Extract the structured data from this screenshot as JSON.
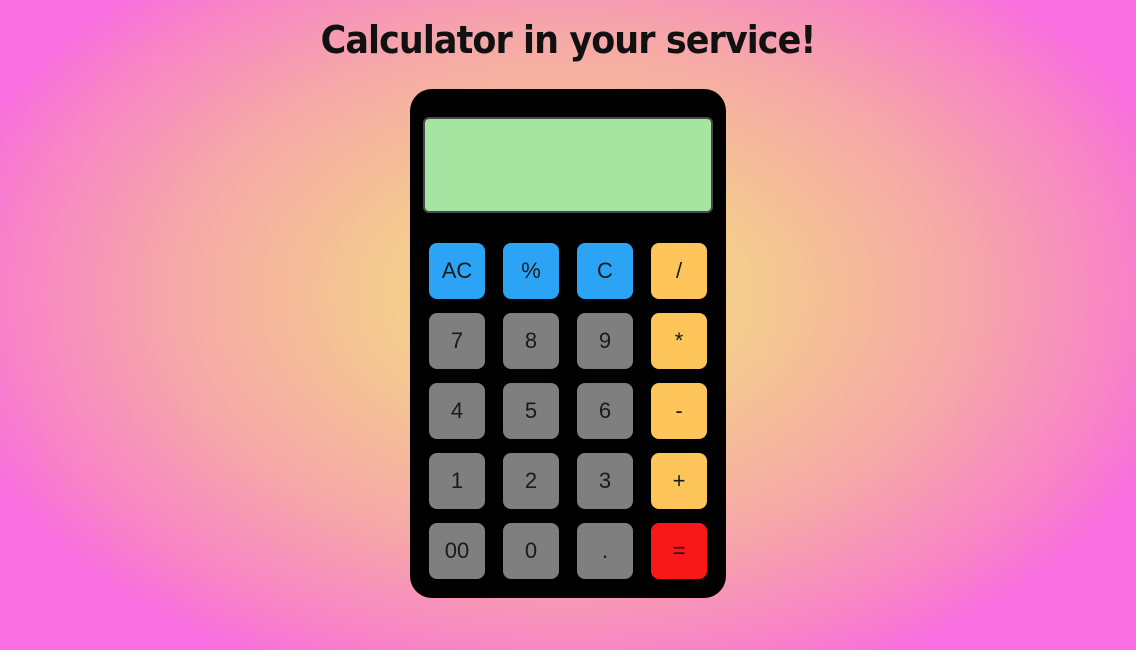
{
  "header": {
    "title": "Calculator in your service!"
  },
  "display": {
    "value": ""
  },
  "colors": {
    "function_keys": "#2ba4f6",
    "number_keys": "#7f7f7f",
    "operator_keys": "#fdc55a",
    "equals_key": "#f91818",
    "display_bg": "#a6e5a1",
    "body": "#000000"
  },
  "keys": {
    "ac": "AC",
    "percent": "%",
    "clear": "C",
    "divide": "/",
    "seven": "7",
    "eight": "8",
    "nine": "9",
    "multiply": "*",
    "four": "4",
    "five": "5",
    "six": "6",
    "minus": "-",
    "one": "1",
    "two": "2",
    "three": "3",
    "plus": "+",
    "double_zero": "00",
    "zero": "0",
    "decimal": ".",
    "equals": "="
  }
}
